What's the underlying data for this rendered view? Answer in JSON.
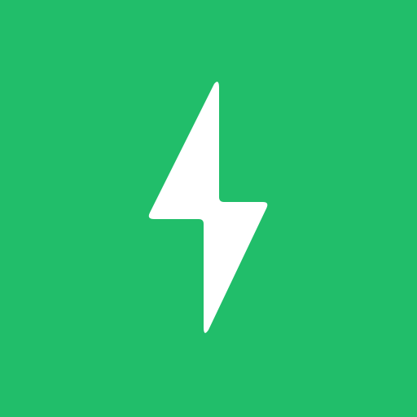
{
  "icon": {
    "name": "lightning-bolt-icon",
    "background_color": "#21BE6A",
    "glyph_color": "#FFFFFF"
  }
}
